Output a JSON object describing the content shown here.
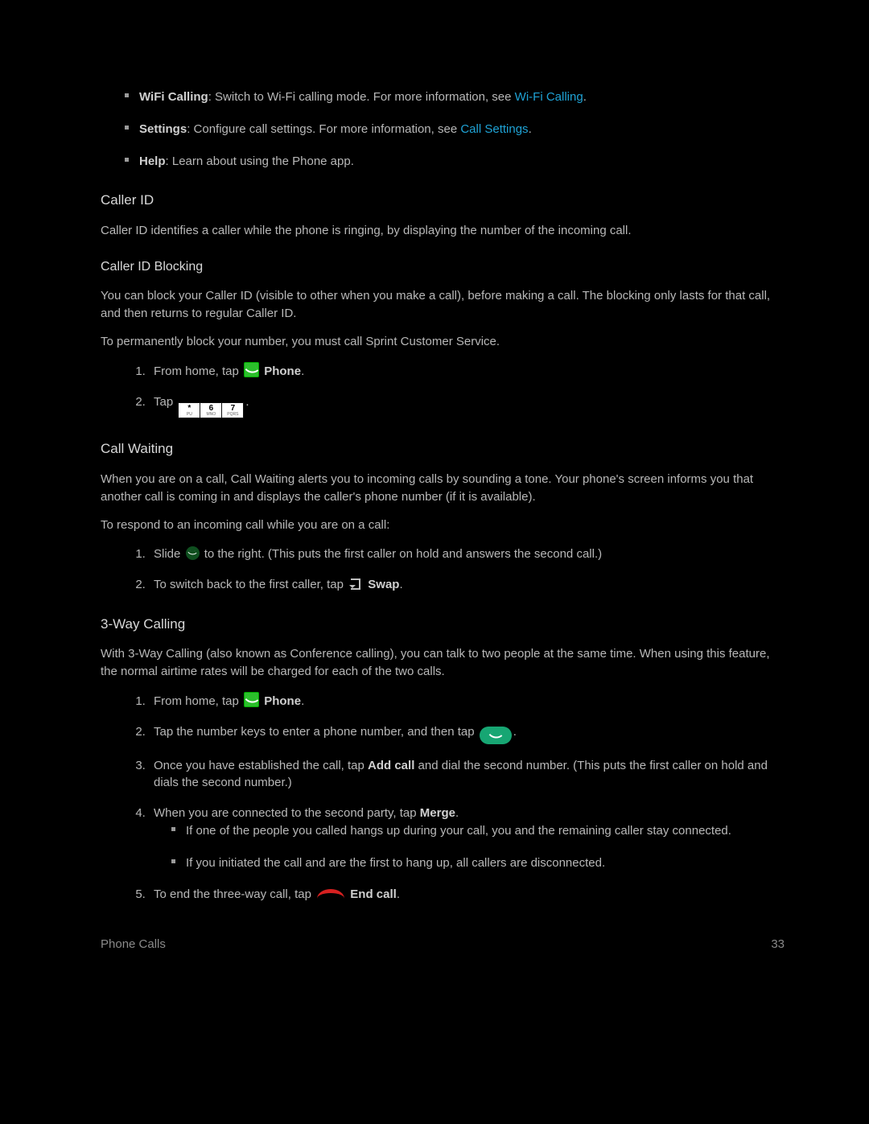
{
  "top_bullets": [
    {
      "strong": "WiFi Calling",
      "rest": ": Switch to Wi-Fi calling mode. For more information, see ",
      "link": "Wi-Fi Calling",
      "tail": "."
    },
    {
      "strong": "Settings",
      "rest": ": Configure call settings. For more information, see ",
      "link": "Call Settings",
      "tail": "."
    },
    {
      "strong": "Help",
      "rest": ": Learn about using the Phone app.",
      "link": "",
      "tail": ""
    }
  ],
  "h_callerid": "Caller ID",
  "p_callerid": "Caller ID identifies a caller while the phone is ringing, by displaying the number of the incoming call.",
  "h_blocking": "Caller ID Blocking",
  "p_blocking1": "You can block your Caller ID (visible to other when you make a call), before making a call. The blocking only lasts for that call, and then returns to regular Caller ID.",
  "p_blocking2": "To permanently block your number, you must call Sprint Customer Service.",
  "blocking_steps": {
    "s1_pre": "From home, tap ",
    "s1_bold": "Phone",
    "s1_post": ".",
    "s2_pre": "Tap ",
    "keys": [
      "*",
      "6",
      "7"
    ],
    "keys_sub": [
      "PU",
      "MNO",
      "PQRS"
    ],
    "s2_post": "."
  },
  "h_waiting": "Call Waiting",
  "p_waiting1": "When you are on a call, Call Waiting alerts you to incoming calls by sounding a tone. Your phone's screen informs you that another call is coming in and displays the caller's phone number (if it is available).",
  "p_waiting2": "To respond to an incoming call while you are on a call:",
  "waiting_steps": {
    "s1_pre": "Slide ",
    "s1_post": " to the right. (This puts the first caller on hold and answers the second call.)",
    "s2_pre": "To switch back to the first caller, tap ",
    "s2_bold": "Swap",
    "s2_post": "."
  },
  "h_threeway": "3-Way Calling",
  "p_threeway": "With 3-Way Calling (also known as Conference calling), you can talk to two people at the same time. When using this feature, the normal airtime rates will be charged for each of the two calls.",
  "threeway_steps": {
    "s1_pre": "From home, tap ",
    "s1_bold": "Phone",
    "s1_post": ".",
    "s2_pre": "Tap the number keys to enter a phone number, and then tap ",
    "s2_post": ".",
    "s3_pre": "Once you have established the call, tap ",
    "s3_bold": "Add call",
    "s3_post": " and dial the second number. (This puts the first caller on hold and dials the second number.)",
    "s4_pre": "When you are connected to the second party, tap ",
    "s4_bold": "Merge",
    "s4_post": ".",
    "s4_sub1": "If one of the people you called hangs up during your call, you and the remaining caller stay connected.",
    "s4_sub2": "If you initiated the call and are the first to hang up, all callers are disconnected.",
    "s5_pre": "To end the three-way call, tap ",
    "s5_bold": "End call",
    "s5_post": "."
  },
  "footer_left": "Phone Calls",
  "footer_right": "33"
}
